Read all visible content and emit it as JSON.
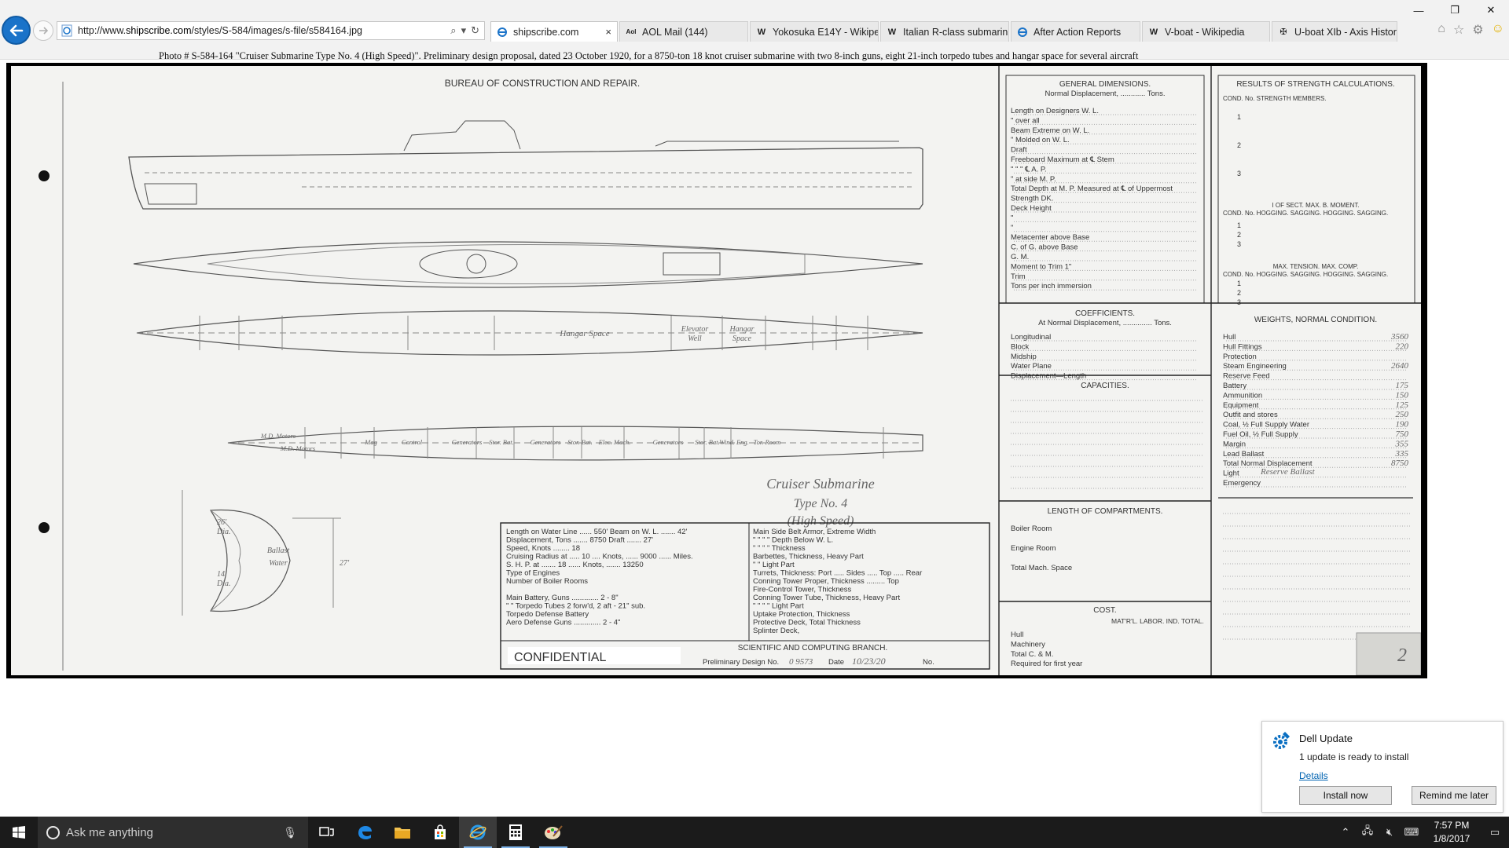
{
  "browser": {
    "url_prefix": "http://www.",
    "url_domain": "shipscribe.com",
    "url_suffix": "/styles/S-584/images/s-file/s584164.jpg",
    "tabs": [
      {
        "label": "shipscribe.com",
        "icon": "ie-page-icon",
        "active": true,
        "closable": true
      },
      {
        "label": "AOL Mail (144)",
        "icon": "aol-icon"
      },
      {
        "label": "Yokosuka E14Y - Wikipe...",
        "icon": "wikipedia-icon"
      },
      {
        "label": "Italian R-class submarin...",
        "icon": "wikipedia-icon"
      },
      {
        "label": "After Action Reports",
        "icon": "ie-page-icon"
      },
      {
        "label": "V-boat - Wikipedia",
        "icon": "wikipedia-icon"
      },
      {
        "label": "U-boat XIb - Axis Histor...",
        "icon": "axis-history-icon"
      }
    ],
    "tab_close_glyph": "×",
    "window_controls": [
      "—",
      "❐",
      "✕"
    ]
  },
  "caption": "Photo #  S-584-164     \"Cruiser Submarine  Type No. 4  (High Speed)\".  Preliminary design proposal, dated 23 October 1920, for a 8750-ton 18 knot cruiser submarine with two 8-inch guns, eight 21-inch torpedo tubes and hangar space for several aircraft",
  "drawing": {
    "header": "BUREAU  OF  CONSTRUCTION  AND  REPAIR.",
    "hull_labels": {
      "hangar_space_1": "Hangar  Space",
      "elevator_well_1": "Elevator",
      "elevator_well_2": "Well",
      "hangar_space_2a": "Hangar",
      "hangar_space_2b": "Space"
    },
    "machinery_labels": [
      "M.D. Motors",
      "M.D. Motors",
      "Mag",
      "Control",
      "Generators",
      "Stor. Bat.",
      "Generators",
      "Stor. Bat.",
      "Elec. Mach.",
      "Generators",
      "Stor. Bat.",
      "Wind. Eng.",
      "Tor. Room"
    ],
    "title_block": {
      "line1": "Cruiser  Submarine",
      "line2": "Type  No. 4",
      "line3": "(High  Speed)"
    },
    "section_labels": {
      "dia_top": "26'",
      "dia_top_unit": "Dia.",
      "dia_bottom": "14'",
      "dia_bottom_unit": "Dia.",
      "ballast_1": "Ballast",
      "ballast_2": "Water",
      "height": "27'"
    },
    "particulars_left": [
      "Length on Water Line ...... 550'     Beam on W. L. ....... 42'",
      "Displacement, Tons ....... 8750         Draft ....... 27'",
      "Speed, Knots ........ 18",
      "Cruising Radius at ..... 10 .... Knots, ...... 9000 ...... Miles.",
      "S. H. P. at ....... 18 ...... Knots, ....... 13250",
      "Type of Engines",
      "Number of Boiler Rooms",
      "",
      "Main Battery, Guns ............. 2 - 8\"",
      "    \"       \"     Torpedo Tubes 2 forw'd, 2 aft - 21\" sub.",
      "Torpedo Defense Battery",
      "Aero Defense Guns ............. 2 - 4\""
    ],
    "particulars_right": [
      "Main Side Belt Armor, Extreme Width",
      "  \"     \"     \"     \"    Depth Below W. L.",
      "  \"     \"     \"     \"    Thickness",
      "Barbettes, Thickness, Heavy Part",
      "   \"           \"          Light Part",
      "Turrets, Thickness: Port ..... Sides ..... Top ..... Rear",
      "Conning Tower Proper, Thickness ......... Top",
      "Fire-Control Tower, Thickness",
      "Conning Tower Tube, Thickness, Heavy Part",
      "   \"          \"        \"          \"        Light Part",
      "Uptake Protection, Thickness",
      "Protective Deck, Total Thickness",
      "Splinter Deck,"
    ],
    "sci_branch": "SCIENTIFIC  AND  COMPUTING  BRANCH.",
    "prelim_no_label": "Preliminary Design No.",
    "prelim_no": "0 9573",
    "date_label": "Date",
    "date_value": "10/23/20",
    "no_label": "No.",
    "confidential": "CONFIDENTIAL",
    "general_dimensions": {
      "title": "GENERAL  DIMENSIONS.",
      "subtitle": "Normal Displacement, ............ Tons.",
      "rows": [
        "Length on Designers W. L.",
        "     \"    over all",
        "Beam Extreme on W. L.",
        "   \"    Molded on W. L.",
        "Draft",
        "Freeboard Maximum at ℄ Stem",
        "     \"        \"      \"  ℄ A. P.",
        "     \"       at side    M. P.",
        "Total Depth at M. P. Measured at ℄ of Uppermost",
        "   Strength DK.",
        "Deck Height",
        "     \"",
        "     \"",
        "Metacenter above Base",
        "C. of G. above Base",
        "G. M.",
        "Moment to Trim 1\"",
        "Trim",
        "Tons per inch immersion"
      ]
    },
    "coefficients": {
      "title": "COEFFICIENTS.",
      "subtitle": "At Normal Displacement, .............. Tons.",
      "rows": [
        "Longitudinal",
        "Block",
        "Midship",
        "Water Plane",
        "Displacement—Length"
      ]
    },
    "capacities_title": "CAPACITIES.",
    "compartments": {
      "title": "LENGTH  OF  COMPARTMENTS.",
      "rows": [
        "Boiler Room",
        "Engine Room",
        "Total Mach. Space"
      ]
    },
    "cost": {
      "title": "COST.",
      "columns": "MAT'R'L.   LABOR.   IND.   TOTAL.",
      "rows": [
        "Hull",
        "Machinery",
        "Total C. & M.",
        "Required for first year"
      ]
    },
    "strength": {
      "title": "RESULTS  OF  STRENGTH  CALCULATIONS.",
      "head1": "COND. No.          STRENGTH MEMBERS.",
      "head2a": "I OF SECT.         MAX. B. MOMENT.",
      "head2b": "COND. No.   HOGGING.  SAGGING.  HOGGING.  SAGGING.",
      "head3a": "MAX. TENSION.         MAX. COMP.",
      "head3b": "COND. No.   HOGGING.  SAGGING.  HOGGING.  SAGGING.",
      "conds": [
        "1",
        "2",
        "3"
      ]
    },
    "weights": {
      "title": "WEIGHTS,  NORMAL  CONDITION.",
      "rows": [
        {
          "label": "Hull",
          "value": "3560"
        },
        {
          "label": "Hull Fittings",
          "value": "220"
        },
        {
          "label": "Protection",
          "value": ""
        },
        {
          "label": "Steam Engineering",
          "value": "2640"
        },
        {
          "label": "Reserve Feed",
          "value": ""
        },
        {
          "label": "Battery",
          "value": "175"
        },
        {
          "label": "Ammunition",
          "value": "150"
        },
        {
          "label": "Equipment",
          "value": "125"
        },
        {
          "label": "Outfit and stores",
          "value": "250"
        },
        {
          "label": "Coal, ½ Full Supply  Water",
          "value": "190"
        },
        {
          "label": "Fuel Oil, ½ Full Supply",
          "value": "750"
        },
        {
          "label": "Margin",
          "value": "355"
        },
        {
          "label": "Lead Ballast",
          "value": "335"
        },
        {
          "label": "Total Normal Displacement",
          "value": "8750"
        },
        {
          "label": "Light",
          "value": ""
        },
        {
          "label": "Emergency",
          "value": ""
        }
      ],
      "reserve_note": "Reserve Ballast"
    },
    "sheet_number": "2"
  },
  "toast": {
    "title": "Dell Update",
    "body": "1 update is ready to install",
    "link": "Details",
    "btn_install": "Install now",
    "btn_later": "Remind me later"
  },
  "taskbar": {
    "search_placeholder": "Ask me anything",
    "apps": [
      "task-view-icon",
      "edge-icon",
      "file-explorer-icon",
      "store-icon",
      "internet-explorer-icon",
      "calculator-icon",
      "paint-icon"
    ],
    "time": "7:57 PM",
    "date": "1/8/2017"
  },
  "colors": {
    "accent": "#1a73c9",
    "taskbar": "#1b1b1b",
    "paper": "#f3f3f1",
    "ink": "#333333"
  }
}
